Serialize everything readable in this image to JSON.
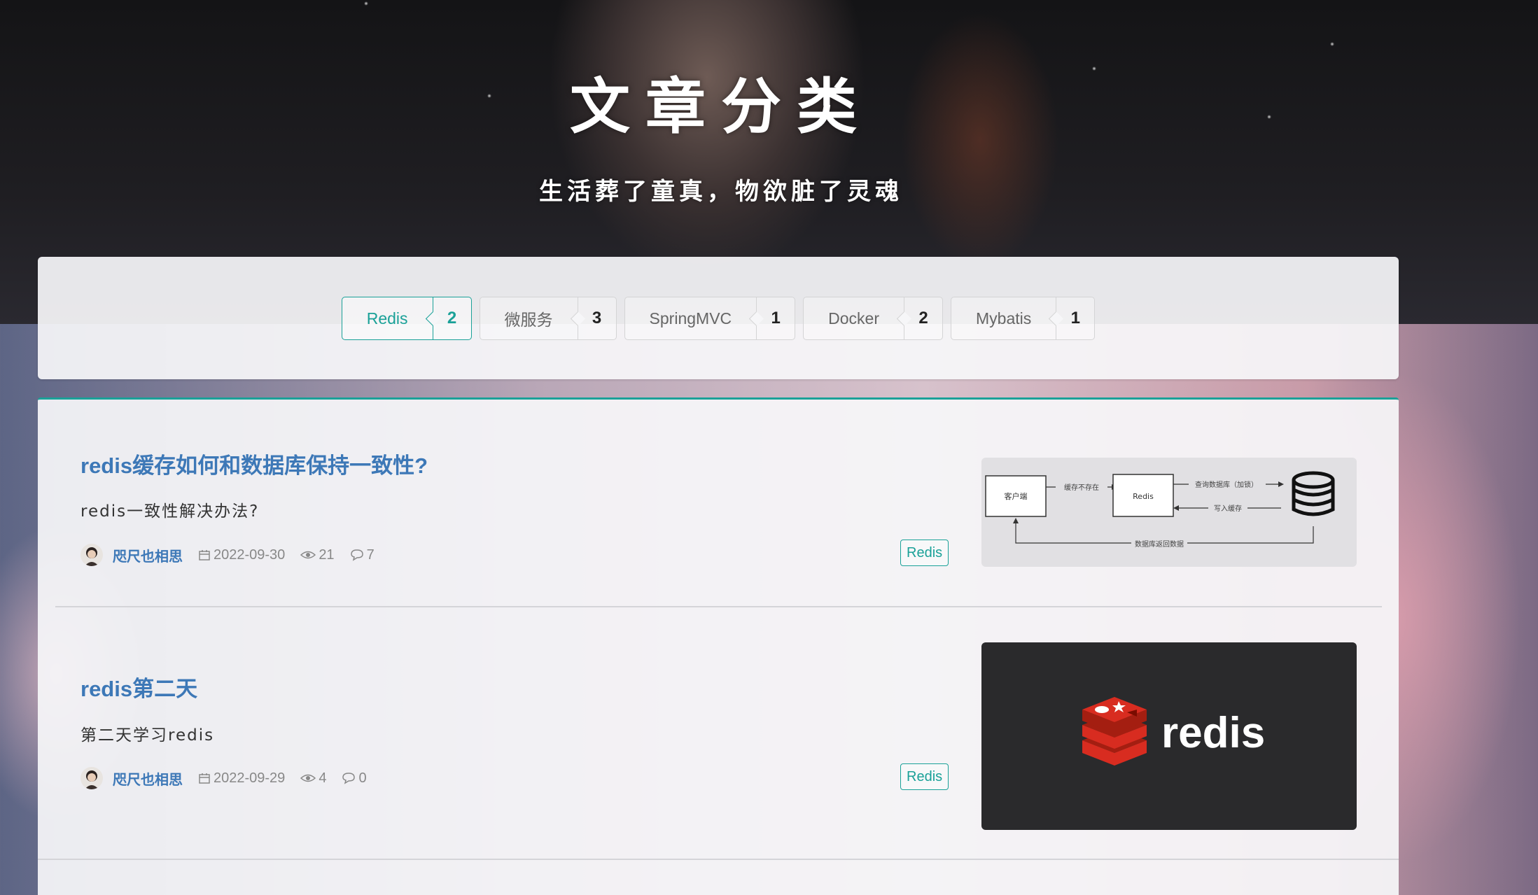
{
  "hero": {
    "title": "文章分类",
    "subtitle": "生活葬了童真，物欲脏了灵魂"
  },
  "categories": [
    {
      "name": "Redis",
      "count": "2",
      "active": true
    },
    {
      "name": "微服务",
      "count": "3",
      "active": false
    },
    {
      "name": "SpringMVC",
      "count": "1",
      "active": false
    },
    {
      "name": "Docker",
      "count": "2",
      "active": false
    },
    {
      "name": "Mybatis",
      "count": "1",
      "active": false
    }
  ],
  "articles": [
    {
      "title": "redis缓存如何和数据库保持一致性?",
      "desc": "redis一致性解决办法?",
      "author": "咫尺也相思",
      "date": "2022-09-30",
      "views": "21",
      "comments": "7",
      "tag": "Redis",
      "diagram": {
        "client": "客户端",
        "cache_miss": "缓存不存在",
        "redis": "Redis",
        "query_db": "查询数据库（加锁）",
        "write_cache": "写入缓存",
        "db_return": "数据库返回数据"
      }
    },
    {
      "title": "redis第二天",
      "desc": "第二天学习redis",
      "author": "咫尺也相思",
      "date": "2022-09-29",
      "views": "4",
      "comments": "0",
      "tag": "Redis",
      "logo_text": "redis"
    }
  ],
  "colors": {
    "accent": "#1aa198",
    "title_blue": "#3d78b7",
    "redis_red": "#d82c20"
  }
}
